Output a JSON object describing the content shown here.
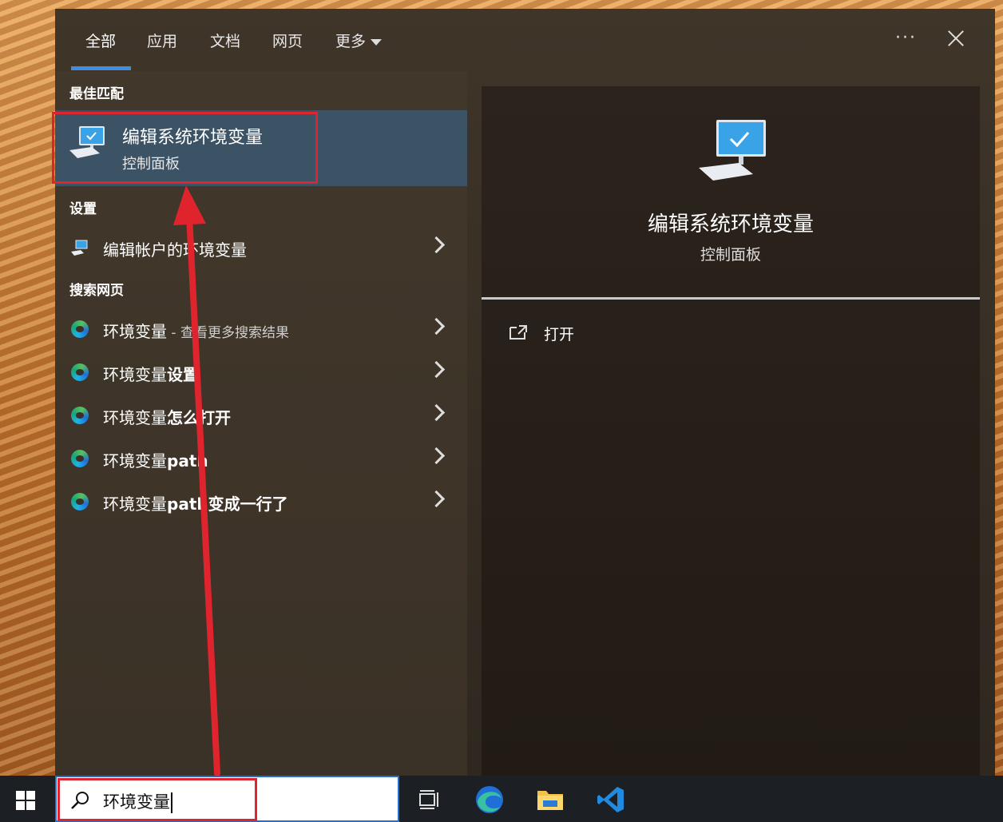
{
  "tabs": [
    {
      "label": "全部",
      "active": true
    },
    {
      "label": "应用"
    },
    {
      "label": "文档"
    },
    {
      "label": "网页"
    },
    {
      "label": "更多"
    }
  ],
  "more_options": "···",
  "sections": {
    "best_match": "最佳匹配",
    "settings": "设置",
    "web": "搜索网页"
  },
  "best_match": {
    "title": "编辑系统环境变量",
    "subtitle": "控制面板"
  },
  "settings_items": [
    {
      "label": "编辑帐户的环境变量"
    }
  ],
  "web_items": [
    {
      "prefix": "环境变量",
      "suffix": " - 查看更多搜索结果"
    },
    {
      "prefix": "环境变量",
      "suffix": "设置"
    },
    {
      "prefix": "环境变量",
      "suffix": "怎么打开"
    },
    {
      "prefix": "环境变量",
      "suffix": "path"
    },
    {
      "prefix": "环境变量",
      "suffix": "path变成一行了"
    }
  ],
  "preview": {
    "title": "编辑系统环境变量",
    "subtitle": "控制面板",
    "actions": [
      {
        "label": "打开"
      }
    ]
  },
  "search": {
    "value": "环境变量"
  },
  "taskbar_icons": [
    "task-view-icon",
    "edge-icon",
    "file-explorer-icon",
    "vscode-icon"
  ],
  "colors": {
    "accent": "#3d8ee0",
    "highlight": "#e0242e",
    "selected_row": "#3c5265"
  }
}
